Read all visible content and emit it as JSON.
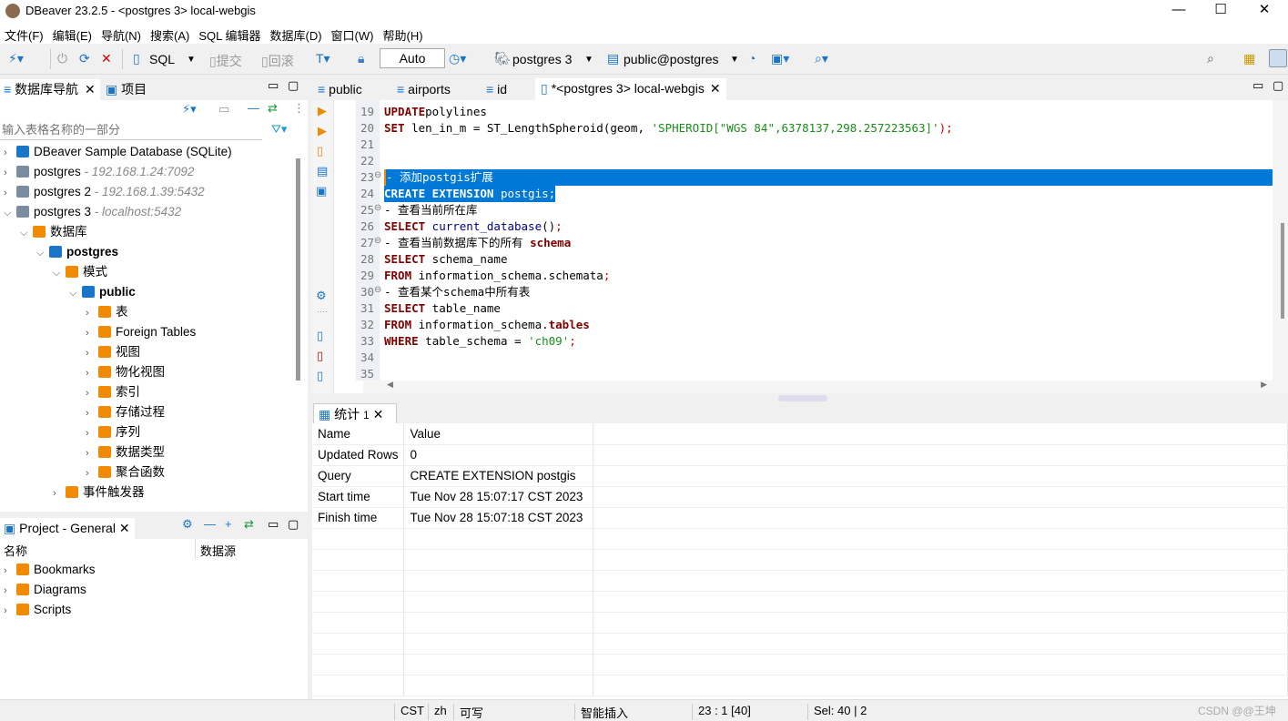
{
  "window": {
    "title": "DBeaver 23.2.5 - <postgres 3> local-webgis",
    "minimize": "—",
    "maximize": "☐",
    "close": "✕"
  },
  "menu": [
    "文件(F)",
    "编辑(E)",
    "导航(N)",
    "搜索(A)",
    "SQL 编辑器",
    "数据库(D)",
    "窗口(W)",
    "帮助(H)"
  ],
  "toolbar": {
    "sql": "SQL",
    "commit": "提交",
    "rollback": "回滚",
    "auto": "Auto",
    "connection": "postgres 3",
    "schema": "public@postgres"
  },
  "nav": {
    "tab1": "数据库导航",
    "tab2": "项目",
    "filter_placeholder": "输入表格名称的一部分",
    "tree": [
      {
        "level": 0,
        "exp": ">",
        "icon": "sqlite-icon",
        "label": "DBeaver Sample Database (SQLite)",
        "host": ""
      },
      {
        "level": 0,
        "exp": ">",
        "icon": "postgres-icon",
        "label": "postgres",
        "host": " - 192.168.1.24:7092"
      },
      {
        "level": 0,
        "exp": ">",
        "icon": "postgres-icon",
        "label": "postgres 2",
        "host": " - 192.168.1.39:5432"
      },
      {
        "level": 0,
        "exp": "v",
        "icon": "postgres-connected-icon",
        "label": "postgres 3",
        "host": " - localhost:5432"
      },
      {
        "level": 1,
        "exp": "v",
        "icon": "folder-db-icon",
        "label": "数据库",
        "host": ""
      },
      {
        "level": 2,
        "exp": "v",
        "icon": "database-icon",
        "label": "postgres",
        "host": "",
        "bold": true
      },
      {
        "level": 3,
        "exp": "v",
        "icon": "schemas-icon",
        "label": "模式",
        "host": ""
      },
      {
        "level": 4,
        "exp": "v",
        "icon": "schema-icon",
        "label": "public",
        "host": "",
        "bold": true
      },
      {
        "level": 5,
        "exp": ">",
        "icon": "tables-icon",
        "label": "表",
        "host": ""
      },
      {
        "level": 5,
        "exp": ">",
        "icon": "foreign-tables-icon",
        "label": "Foreign Tables",
        "host": ""
      },
      {
        "level": 5,
        "exp": ">",
        "icon": "views-icon",
        "label": "视图",
        "host": ""
      },
      {
        "level": 5,
        "exp": ">",
        "icon": "mat-views-icon",
        "label": "物化视图",
        "host": ""
      },
      {
        "level": 5,
        "exp": ">",
        "icon": "folder-icon",
        "label": "索引",
        "host": ""
      },
      {
        "level": 5,
        "exp": ">",
        "icon": "folder-icon",
        "label": "存储过程",
        "host": ""
      },
      {
        "level": 5,
        "exp": ">",
        "icon": "folder-icon",
        "label": "序列",
        "host": ""
      },
      {
        "level": 5,
        "exp": ">",
        "icon": "folder-icon",
        "label": "数据类型",
        "host": ""
      },
      {
        "level": 5,
        "exp": ">",
        "icon": "folder-icon",
        "label": "聚合函数",
        "host": ""
      },
      {
        "level": 3,
        "exp": ">",
        "icon": "folder-icon",
        "label": "事件触发器",
        "host": ""
      }
    ]
  },
  "project": {
    "tab": "Project - General",
    "col_name": "名称",
    "col_source": "数据源",
    "items": [
      "Bookmarks",
      "Diagrams",
      "Scripts"
    ]
  },
  "editor_tabs": [
    {
      "label": "public"
    },
    {
      "label": "airports"
    },
    {
      "label": "id"
    },
    {
      "label": "*<postgres 3> local-webgis",
      "active": true
    }
  ],
  "code": [
    {
      "n": "19",
      "tokens": [
        [
          "kw",
          "UPDATE"
        ],
        [
          "",
          "polylines"
        ]
      ]
    },
    {
      "n": "20",
      "tokens": [
        [
          "kw",
          "SET"
        ],
        [
          "",
          " len_in_m = ST_LengthSpheroid(geom, "
        ],
        [
          "str",
          "'SPHEROID[\"WGS 84\",6378137,298.257223563]'"
        ],
        [
          "pn",
          ");"
        ]
      ]
    },
    {
      "n": "21",
      "tokens": []
    },
    {
      "n": "22",
      "tokens": []
    },
    {
      "n": "23",
      "fold": true,
      "selected": "full",
      "tokens": [
        [
          "cm",
          "- 添加postgis扩展"
        ]
      ]
    },
    {
      "n": "24",
      "selected": "partial",
      "tokens": [
        [
          "kw",
          "CREATE EXTENSION"
        ],
        [
          "",
          " postgis;"
        ]
      ]
    },
    {
      "n": "25",
      "fold": true,
      "tokens": [
        [
          "cm",
          "- 查看当前所在库"
        ]
      ]
    },
    {
      "n": "26",
      "tokens": [
        [
          "kw",
          "SELECT"
        ],
        [
          "fn",
          " current_database"
        ],
        [
          "",
          "()"
        ],
        [
          "pn",
          ";"
        ]
      ]
    },
    {
      "n": "27",
      "fold": true,
      "tokens": [
        [
          "cm",
          "- 查看当前数据库下的所有 "
        ],
        [
          "kw",
          "schema"
        ]
      ]
    },
    {
      "n": "28",
      "tokens": [
        [
          "kw",
          "SELECT"
        ],
        [
          "",
          " schema_name"
        ]
      ]
    },
    {
      "n": "29",
      "tokens": [
        [
          "kw",
          "FROM"
        ],
        [
          "",
          " information_schema.schemata"
        ],
        [
          "pn",
          ";"
        ]
      ]
    },
    {
      "n": "30",
      "fold": true,
      "tokens": [
        [
          "cm",
          "- 查看某个schema中所有表"
        ]
      ]
    },
    {
      "n": "31",
      "tokens": [
        [
          "kw",
          "SELECT"
        ],
        [
          "",
          " table_name"
        ]
      ]
    },
    {
      "n": "32",
      "tokens": [
        [
          "kw",
          "FROM"
        ],
        [
          "",
          " information_schema."
        ],
        [
          "kw",
          "tables"
        ]
      ]
    },
    {
      "n": "33",
      "tokens": [
        [
          "kw",
          "WHERE"
        ],
        [
          "",
          " table_schema = "
        ],
        [
          "str",
          "'ch09'"
        ],
        [
          "pn",
          ";"
        ]
      ]
    },
    {
      "n": "34",
      "tokens": []
    },
    {
      "n": "35",
      "tokens": []
    }
  ],
  "results": {
    "tab": "统计",
    "tab_count": "1",
    "headers": [
      "Name",
      "Value"
    ],
    "rows": [
      [
        "Updated Rows",
        "0"
      ],
      [
        "Query",
        "CREATE EXTENSION postgis"
      ],
      [
        "Start time",
        "Tue Nov 28 15:07:17 CST 2023"
      ],
      [
        "Finish time",
        "Tue Nov 28 15:07:18 CST 2023"
      ]
    ]
  },
  "status": {
    "tz": "CST",
    "locale": "zh",
    "mode": "可写",
    "insert": "智能插入",
    "pos": "23 : 1 [40]",
    "sel": "Sel: 40 | 2",
    "watermark": "CSDN @@王坤"
  }
}
